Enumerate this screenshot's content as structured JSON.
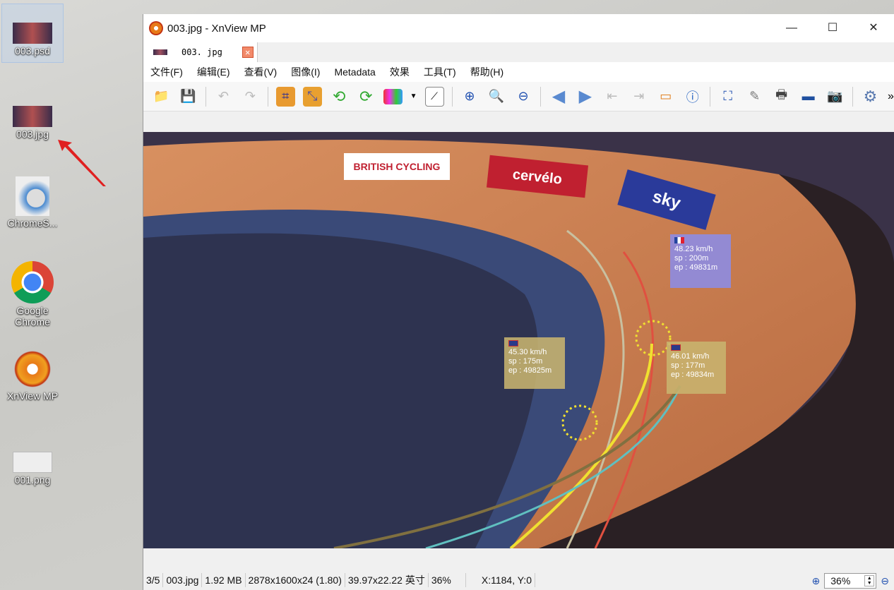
{
  "desktop": {
    "icons": [
      {
        "label": "003.psd"
      },
      {
        "label": "003.jpg"
      },
      {
        "label": "ChromeS..."
      },
      {
        "label": "Google Chrome"
      },
      {
        "label": "XnView MP"
      },
      {
        "label": "001.png"
      }
    ]
  },
  "window": {
    "title": "003.jpg - XnView MP",
    "minimize": "—",
    "maximize": "☐",
    "close": "✕"
  },
  "tab": {
    "label": "003. jpg",
    "close": "✕"
  },
  "menu": [
    "文件(F)",
    "编辑(E)",
    "查看(V)",
    "图像(I)",
    "Metadata",
    "效果",
    "工具(T)",
    "帮助(H)"
  ],
  "toolbar": {
    "more": "»"
  },
  "overlays": [
    {
      "flag": "uk",
      "speed": "45.30 km/h",
      "sp": "sp : 175m",
      "ep": "ep : 49825m"
    },
    {
      "flag": "fr",
      "speed": "48.23 km/h",
      "sp": "sp : 200m",
      "ep": "ep : 49831m"
    },
    {
      "flag": "uk",
      "speed": "46.01 km/h",
      "sp": "sp : 177m",
      "ep": "ep : 49834m"
    }
  ],
  "image_text": {
    "banner1": "BRITISH CYCLING",
    "banner2": "cervélo",
    "banner3": "sky"
  },
  "status": {
    "index": "3/5",
    "file": "003.jpg",
    "size": "1.92 MB",
    "dims": "2878x1600x24 (1.80)",
    "print": "39.97x22.22 英寸",
    "zoom": "36%",
    "coords": "X:1184, Y:0",
    "zoom_value": "36%"
  }
}
